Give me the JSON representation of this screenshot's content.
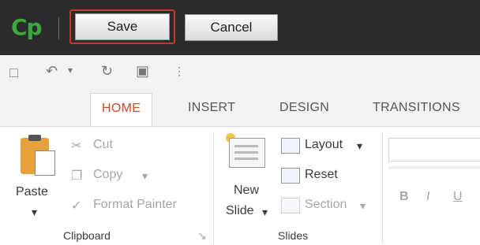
{
  "app": {
    "logo": "Cp"
  },
  "toolbar": {
    "save_label": "Save",
    "cancel_label": "Cancel"
  },
  "quick_access": [
    {
      "icon": "save-icon"
    },
    {
      "icon": "undo-icon"
    },
    {
      "icon": "redo-icon"
    },
    {
      "icon": "present-icon"
    }
  ],
  "tabs": [
    {
      "label": "HOME",
      "active": true
    },
    {
      "label": "INSERT"
    },
    {
      "label": "DESIGN"
    },
    {
      "label": "TRANSITIONS"
    }
  ],
  "clipboard": {
    "paste": "Paste",
    "cut": "Cut",
    "copy": "Copy",
    "format_painter": "Format Painter",
    "group_label": "Clipboard"
  },
  "slides": {
    "new_slide_line1": "New",
    "new_slide_line2": "Slide",
    "layout": "Layout",
    "reset": "Reset",
    "section": "Section",
    "group_label": "Slides"
  },
  "font": {
    "bold": "B",
    "italic": "I",
    "underline": "U"
  },
  "colors": {
    "accent": "#d24726",
    "highlight": "#c0392b",
    "logo": "#3aa83a"
  }
}
